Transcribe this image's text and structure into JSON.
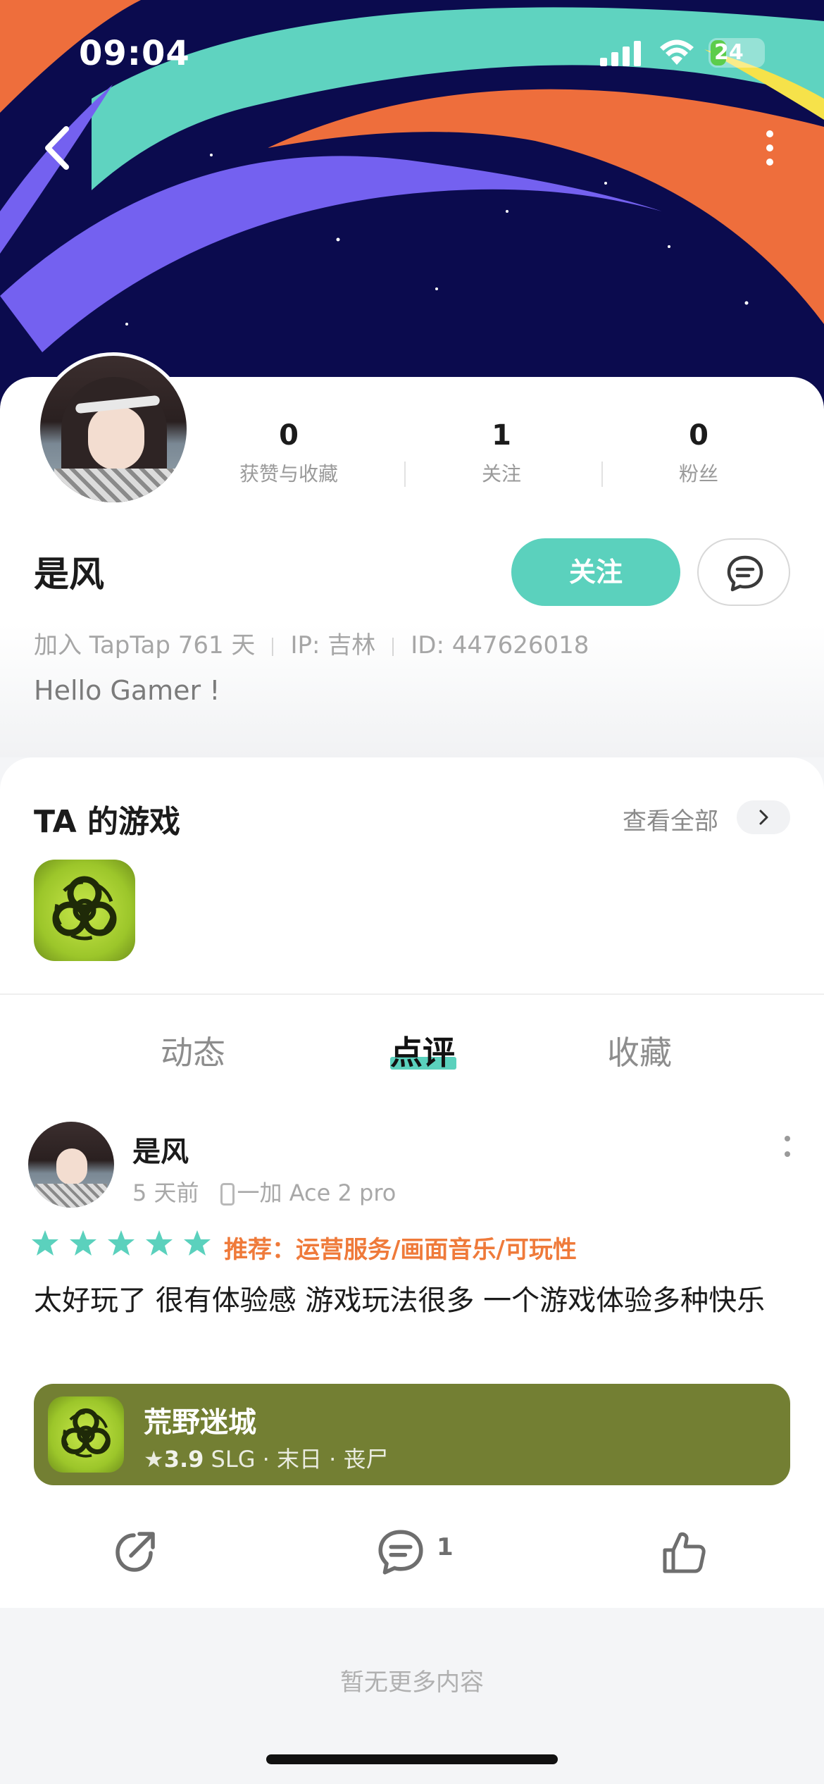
{
  "status_bar": {
    "time": "09:04",
    "battery": "24"
  },
  "profile": {
    "stats": [
      {
        "value": "0",
        "label": "获赞与收藏"
      },
      {
        "value": "1",
        "label": "关注"
      },
      {
        "value": "0",
        "label": "粉丝"
      }
    ],
    "name": "是风",
    "follow_label": "关注",
    "joined": "加入 TapTap 761 天",
    "ip": "IP: 吉林",
    "id": "ID: 447626018",
    "bio": "Hello Gamer !"
  },
  "games": {
    "title": "TA 的游戏",
    "see_all": "查看全部"
  },
  "tabs": [
    {
      "label": "动态",
      "active": false
    },
    {
      "label": "点评",
      "active": true
    },
    {
      "label": "收藏",
      "active": false
    }
  ],
  "review": {
    "author": "是风",
    "time": "5 天前",
    "device": "一加 Ace 2 pro",
    "stars": 5,
    "recommend": "推荐：运营服务/画面音乐/可玩性",
    "text": "太好玩了  很有体验感  游戏玩法很多 一个游戏体验多种快乐",
    "game": {
      "title": "荒野迷城",
      "rating": "3.9",
      "tags": "SLG · 末日 · 丧尸"
    },
    "comment_count": "1"
  },
  "footer": {
    "no_more": "暂无更多内容"
  },
  "colors": {
    "accent": "#5bd1bd",
    "recommend": "#ef7a3a",
    "banner": "#737f33",
    "hero_bg": "#0b0b4e"
  }
}
